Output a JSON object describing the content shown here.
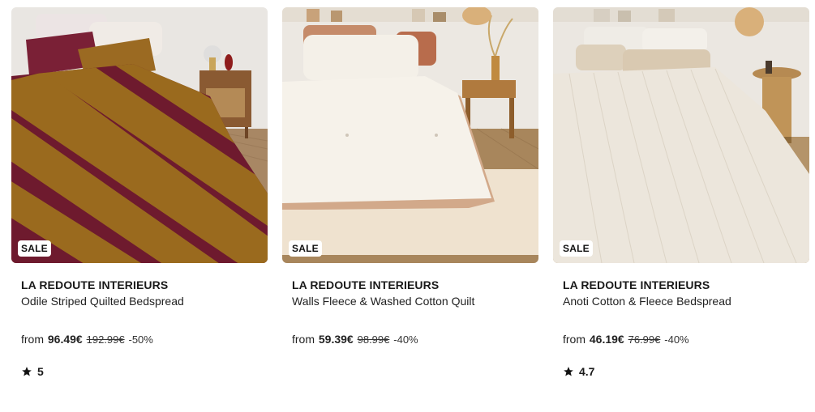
{
  "products": [
    {
      "badge": "SALE",
      "brand": "LA REDOUTE INTERIEURS",
      "name": "Odile Striped Quilted Bedspread",
      "price": {
        "prefix": "from",
        "current": "96.49€",
        "original": "192.99€",
        "discount": "-50%"
      },
      "rating": "5",
      "image": "bedroom-with-burgundy-and-ochre-striped-bedspread",
      "colors": {
        "stripe_a": "#6e1a2e",
        "stripe_b": "#9a6a1e"
      }
    },
    {
      "badge": "SALE",
      "brand": "LA REDOUTE INTERIEURS",
      "name": "Walls Fleece & Washed Cotton Quilt",
      "price": {
        "prefix": "from",
        "current": "59.39€",
        "original": "98.99€",
        "discount": "-40%"
      },
      "rating": null,
      "image": "bedroom-with-cream-fleece-quilt",
      "colors": {
        "quilt": "#f3efe6",
        "trim": "#d2a98a"
      }
    },
    {
      "badge": "SALE",
      "brand": "LA REDOUTE INTERIEURS",
      "name": "Anoti Cotton & Fleece Bedspread",
      "price": {
        "prefix": "from",
        "current": "46.19€",
        "original": "76.99€",
        "discount": "-40%"
      },
      "rating": "4.7",
      "image": "bedroom-with-white-ribbed-bedspread",
      "colors": {
        "spread": "#ece6dc"
      }
    }
  ]
}
